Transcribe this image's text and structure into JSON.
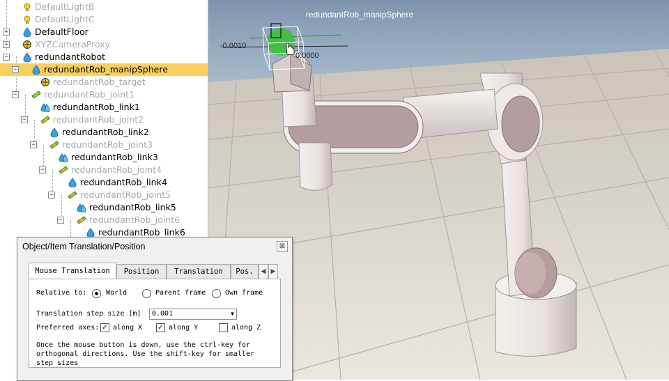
{
  "tree": {
    "items": [
      {
        "label": "DefaultLightB",
        "dim": true,
        "icon": "light-icon"
      },
      {
        "label": "DefaultLightC",
        "dim": true,
        "icon": "light-icon"
      },
      {
        "label": "DefaultFloor",
        "dim": false,
        "icon": "shape-icon"
      },
      {
        "label": "XYZCameraProxy",
        "dim": true,
        "icon": "dummy-icon"
      },
      {
        "label": "redundantRobot",
        "dim": false,
        "icon": "shape-icon"
      },
      {
        "label": "redundantRob_manipSphere",
        "dim": false,
        "icon": "shape-icon",
        "selected": true
      },
      {
        "label": "redundantRob_target",
        "dim": true,
        "icon": "dummy-icon"
      },
      {
        "label": "redundantRob_joint1",
        "dim": true,
        "icon": "joint-icon"
      },
      {
        "label": "redundantRob_link1",
        "dim": false,
        "icon": "multishape-icon"
      },
      {
        "label": "redundantRob_joint2",
        "dim": true,
        "icon": "joint-icon"
      },
      {
        "label": "redundantRob_link2",
        "dim": false,
        "icon": "shape-icon"
      },
      {
        "label": "redundantRob_joint3",
        "dim": true,
        "icon": "joint-icon"
      },
      {
        "label": "redundantRob_link3",
        "dim": false,
        "icon": "multishape-icon"
      },
      {
        "label": "redundantRob_joint4",
        "dim": true,
        "icon": "joint-icon"
      },
      {
        "label": "redundantRob_link4",
        "dim": false,
        "icon": "shape-icon"
      },
      {
        "label": "redundantRob_joint5",
        "dim": true,
        "icon": "joint-icon"
      },
      {
        "label": "redundantRob_link5",
        "dim": false,
        "icon": "multishape-icon"
      },
      {
        "label": "redundantRob_joint6",
        "dim": true,
        "icon": "joint-icon"
      },
      {
        "label": "redundantRob_link6",
        "dim": false,
        "icon": "shape-icon"
      }
    ]
  },
  "viewport": {
    "object_label": "redundantRob_manipSphere",
    "axis_left": "-0.0010",
    "axis_right": "0.0000",
    "sky_color": "#8fa5bf",
    "floor_color": "#d8d2c8",
    "robot_color": "#e9e3e1",
    "manip_color": "#3fbf3f"
  },
  "dialog": {
    "title": "Object/Item Translation/Position",
    "close_glyph": "⊠",
    "tabs": [
      "Mouse Translation",
      "Position",
      "Translation",
      "Pos."
    ],
    "active_tab": 0,
    "relative_to": {
      "label": "Relative to:",
      "options": [
        "World",
        "Parent frame",
        "Own frame"
      ],
      "selected": 0
    },
    "step_size": {
      "label": "Translation step size [m]",
      "value": "0.001"
    },
    "preferred_axes": {
      "label": "Preferred axes:",
      "options": [
        {
          "label": "along X",
          "checked": true
        },
        {
          "label": "along Y",
          "checked": true
        },
        {
          "label": "along Z",
          "checked": false
        }
      ]
    },
    "hint_lines": [
      "Once the mouse button is down, use the ctrl-key for",
      "orthogonal directions. Use the shift-key for smaller",
      "step sizes"
    ]
  }
}
